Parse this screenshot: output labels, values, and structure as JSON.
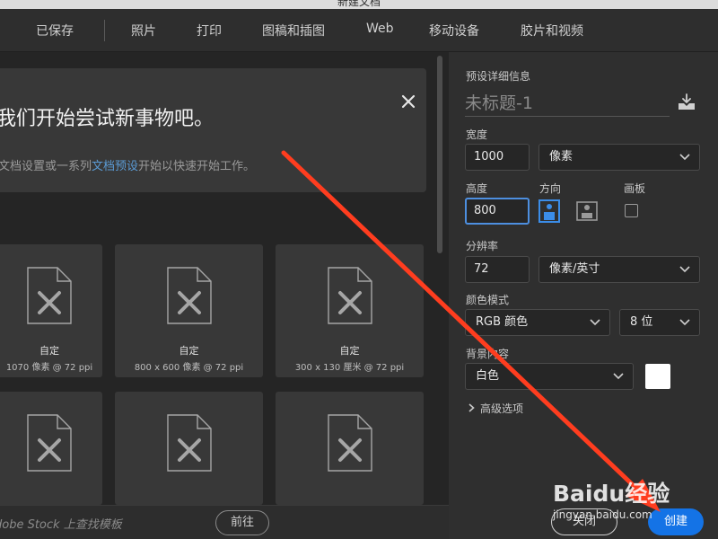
{
  "window": {
    "title": "新建文档"
  },
  "tabs": [
    {
      "label": "已保存"
    },
    {
      "label": "照片"
    },
    {
      "label": "打印"
    },
    {
      "label": "图稿和插图"
    },
    {
      "label": "Web"
    },
    {
      "label": "移动设备"
    },
    {
      "label": "胶片和视频"
    }
  ],
  "welcome": {
    "title": "我们开始尝试新事物吧。",
    "subtitle_before": "文档设置或一系列",
    "subtitle_link": "文档预设",
    "subtitle_after": "开始以快速开始工作。"
  },
  "presets": [
    {
      "title": "自定",
      "subtitle": "1070 像素 @ 72 ppi"
    },
    {
      "title": "自定",
      "subtitle": "800 x 600 像素 @ 72 ppi"
    },
    {
      "title": "自定",
      "subtitle": "300 x 130 厘米 @ 72 ppi"
    },
    {
      "title": "",
      "subtitle": ""
    },
    {
      "title": "",
      "subtitle": ""
    },
    {
      "title": "",
      "subtitle": ""
    }
  ],
  "stock": {
    "search_text": "dobe Stock 上查找模板",
    "go_label": "前往"
  },
  "details": {
    "section_title": "预设详细信息",
    "doc_name": "未标题-1",
    "width_label": "宽度",
    "width_value": "1000",
    "width_unit": "像素",
    "height_label": "高度",
    "height_value": "800",
    "orientation_label": "方向",
    "artboard_label": "画板",
    "resolution_label": "分辨率",
    "resolution_value": "72",
    "resolution_unit": "像素/英寸",
    "color_mode_label": "颜色模式",
    "color_mode_value": "RGB 颜色",
    "bit_depth_value": "8 位",
    "background_label": "背景内容",
    "background_value": "白色",
    "advanced_label": "高级选项"
  },
  "actions": {
    "close_label": "关闭",
    "create_label": "创建"
  },
  "watermark": {
    "text": "Baidu经验",
    "url": "jingyan.baidu.com"
  },
  "colors": {
    "accent": "#1473e6",
    "arrow": "#ff3d1f",
    "link": "#5b9bd5",
    "focus": "#4d8fe0"
  }
}
